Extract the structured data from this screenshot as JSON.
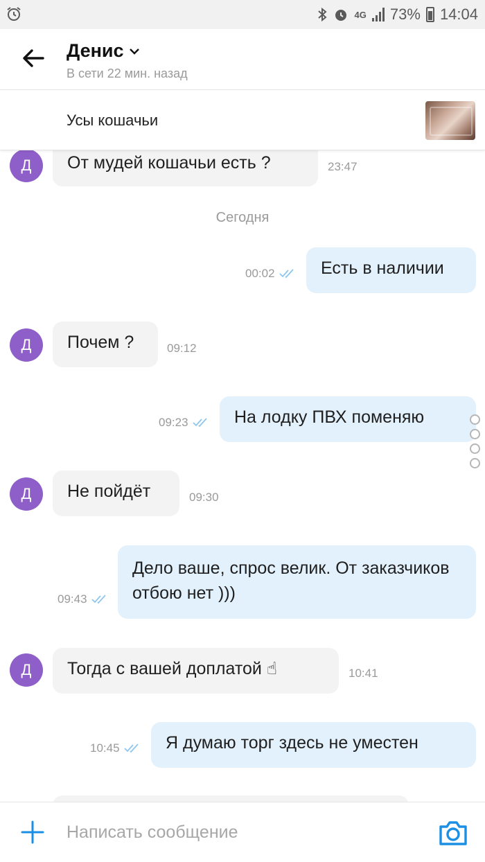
{
  "statusbar": {
    "network": "4G",
    "battery": "73%",
    "time": "14:04"
  },
  "header": {
    "name": "Денис",
    "status": "В сети 22 мин. назад"
  },
  "item": {
    "title": "Усы кошачьи"
  },
  "date_separator": "Сегодня",
  "messages": [
    {
      "dir": "in",
      "avatar": "Д",
      "text": "От мудей кошачьи есть ?",
      "time": "23:47"
    },
    {
      "dir": "out",
      "text": "Есть в наличии",
      "time": "00:02",
      "read": true
    },
    {
      "dir": "in",
      "avatar": "Д",
      "text": "Почем ?",
      "time": "09:12"
    },
    {
      "dir": "out",
      "text": "На лодку ПВХ поменяю",
      "time": "09:23",
      "read": true
    },
    {
      "dir": "in",
      "avatar": "Д",
      "text": "Не пойдёт",
      "time": "09:30"
    },
    {
      "dir": "out",
      "text": "Дело ваше, спрос велик. От заказчиков отбою нет )))",
      "time": "09:43",
      "read": true
    },
    {
      "dir": "in",
      "avatar": "Д",
      "text": "Тогда с вашей доплатой ☝",
      "time": "10:41"
    },
    {
      "dir": "out",
      "text": "Я думаю торг здесь не уместен",
      "time": "10:45",
      "read": true
    }
  ],
  "composer": {
    "placeholder": "Написать сообщение"
  },
  "colors": {
    "accent": "#1a8fe3",
    "avatar": "#8f5fc9",
    "outgoing_bubble": "#e3f1fc",
    "incoming_bubble": "#f3f3f3"
  },
  "icons": {
    "back": "arrow-left-icon",
    "dropdown": "chevron-down-icon",
    "add": "plus-icon",
    "camera": "camera-icon",
    "read_status": "double-check-icon"
  }
}
